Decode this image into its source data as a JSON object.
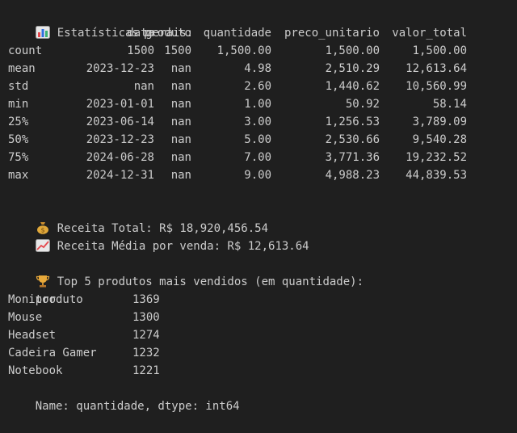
{
  "section_stats": {
    "icon": "bar-chart-icon",
    "title": "Estatísticas gerais:"
  },
  "stats_table": {
    "columns": [
      "data",
      "produto",
      "quantidade",
      "preco_unitario",
      "valor_total"
    ],
    "rows": [
      {
        "label": "count",
        "values": [
          "1500",
          "1500",
          "1,500.00",
          "1,500.00",
          "1,500.00"
        ]
      },
      {
        "label": "mean",
        "values": [
          "2023-12-23",
          "nan",
          "4.98",
          "2,510.29",
          "12,613.64"
        ]
      },
      {
        "label": "std",
        "values": [
          "nan",
          "nan",
          "2.60",
          "1,440.62",
          "10,560.99"
        ]
      },
      {
        "label": "min",
        "values": [
          "2023-01-01",
          "nan",
          "1.00",
          "50.92",
          "58.14"
        ]
      },
      {
        "label": "25%",
        "values": [
          "2023-06-14",
          "nan",
          "3.00",
          "1,256.53",
          "3,789.09"
        ]
      },
      {
        "label": "50%",
        "values": [
          "2023-12-23",
          "nan",
          "5.00",
          "2,530.66",
          "9,540.28"
        ]
      },
      {
        "label": "75%",
        "values": [
          "2024-06-28",
          "nan",
          "7.00",
          "3,771.36",
          "19,232.52"
        ]
      },
      {
        "label": "max",
        "values": [
          "2024-12-31",
          "nan",
          "9.00",
          "4,988.23",
          "44,839.53"
        ]
      }
    ]
  },
  "revenue": {
    "total_icon": "money-bag-icon",
    "total_text": "Receita Total: R$ 18,920,456.54",
    "mean_icon": "trend-up-icon",
    "mean_text": "Receita Média por venda: R$ 12,613.64"
  },
  "top_products": {
    "icon": "trophy-icon",
    "title": "Top 5 produtos mais vendidos (em quantidade):",
    "index_name": "produto",
    "items": [
      {
        "name": "Monitor",
        "value": "1369"
      },
      {
        "name": "Mouse",
        "value": "1300"
      },
      {
        "name": "Headset",
        "value": "1274"
      },
      {
        "name": "Cadeira Gamer",
        "value": "1232"
      },
      {
        "name": "Notebook",
        "value": "1221"
      }
    ],
    "footer": "Name: quantidade, dtype: int64"
  }
}
